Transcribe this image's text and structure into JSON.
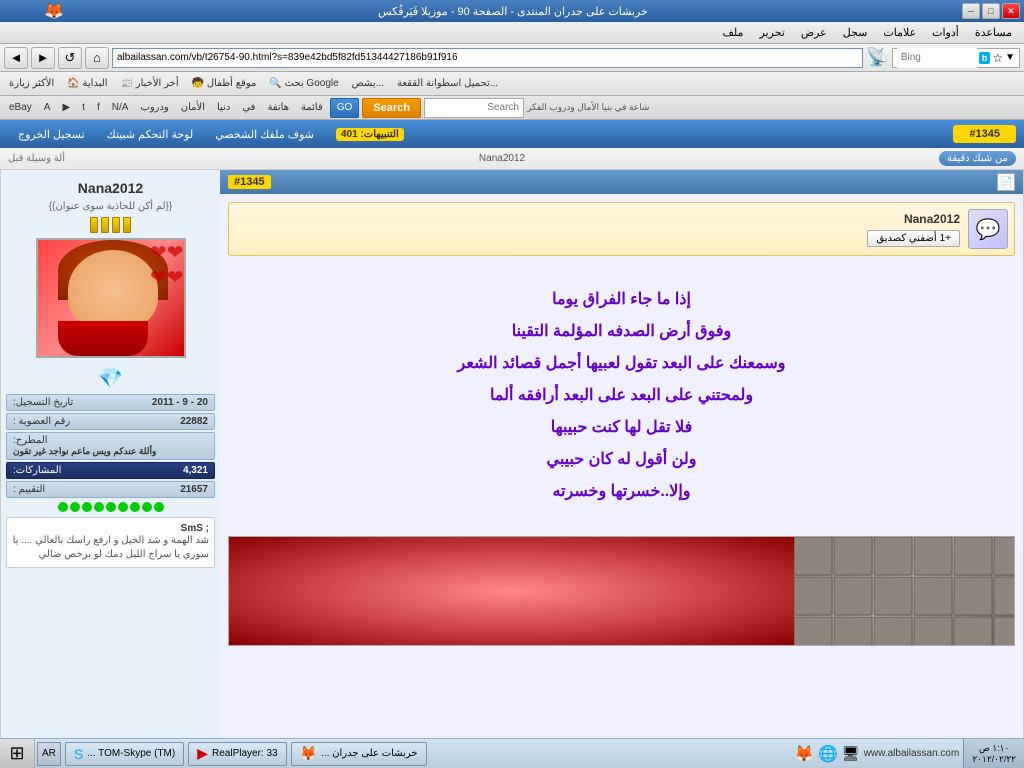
{
  "window": {
    "title": "خربشات على جدران المنتدى - الصفحة 90 - موزيلا فَيَرفُكس",
    "minimize": "─",
    "maximize": "□",
    "close": "✕"
  },
  "menu": {
    "items": [
      "ملف",
      "تحرير",
      "عرض",
      "سجل",
      "علامات",
      "أدوات",
      "مساعدة"
    ]
  },
  "navbar": {
    "address": "albailassan.com/vb/t26754-90.html?s=839e42bd5f82fd51344427186b91f916",
    "search_placeholder": "Bing",
    "back": "◄",
    "forward": "►",
    "refresh": "↺",
    "home": "⌂",
    "go": "GO"
  },
  "bookmarks": {
    "items": [
      "الأكثر زيارة",
      "البداية",
      "أخر الأخبار",
      "موقع أطفال",
      "بحث Google",
      "يشص...",
      "تحميل اسطوانة الققعة..."
    ]
  },
  "toolbar2": {
    "items": [
      "eBay",
      "Amazon",
      "YouTube",
      "Twitter",
      "Facebook",
      "N/A",
      "ودروب",
      "الأمان",
      "دنيا",
      "في",
      "هاتفة",
      "قائمة"
    ],
    "search_label": "Search",
    "search_placeholder": "Search"
  },
  "forum_nav": {
    "notifications": "التنبيهات: 401",
    "show_profile": "شوف ملفك الشخصي",
    "control_panel": "لوحة التحكم شبيتك",
    "logout": "تسجيل الخروج",
    "post_number": "#1345"
  },
  "post_info": {
    "previous_post": "ألة وسيلة قبل",
    "user": "Nana2012",
    "from_badge": "من شبك دقيقة"
  },
  "user_card": {
    "name": "Nana2012",
    "add_friend": "أضفني كصديق",
    "plus_icon": "+1"
  },
  "poem": {
    "lines": [
      "إذا ما جاء الفراق يوما",
      "وفوق أرض الصدفه المؤلمة التقينا",
      "وسمعنك على البعد تقول لعبيها أجمل قصائد الشعر",
      "ولمحتني على البعد على البعد أرافقه ألما",
      "فلا تقل لها كنت حبيبها",
      "ولن أقول له كان حبيبي",
      "وإلا..خسرتها وخسرته"
    ]
  },
  "sidebar": {
    "username": "Nana2012",
    "subtitle": "{{لم أكن للحاذية سوى عنوان}}",
    "bars_count": 4,
    "reg_date_label": "تاريخ التسجيل:",
    "reg_date_value": "20 - 9 - 2011",
    "member_id_label": "رقم العضوية :",
    "member_id_value": "22882",
    "topic_label": "المطرح:",
    "topic_value": "وأللة عندكم ويس ماعم نواجد غير تقون",
    "posts_label": "المشاركات:",
    "posts_value": "4,321",
    "rating_label": "التقييم :",
    "rating_value": "21657",
    "sms_title": "; SmS",
    "sms_text": "شد الهمة و شد الخيل و ارفع راسك بالعالي .... يا سوري يا سراج الليل دمك لو برخص ضالي"
  },
  "statusbar": {
    "time": "١:١٠ ص",
    "date": "٢٠١٢/٠٢/٢٢",
    "lang": "AR",
    "tasks": [
      {
        "label": "... TOM-Skype (TM)",
        "icon": "S"
      },
      {
        "label": "RealPlayer: 33",
        "icon": "▶"
      },
      {
        "label": "... خربشات على جدران",
        "icon": "🦊"
      }
    ],
    "site_logo": "www.albailassan.com"
  }
}
